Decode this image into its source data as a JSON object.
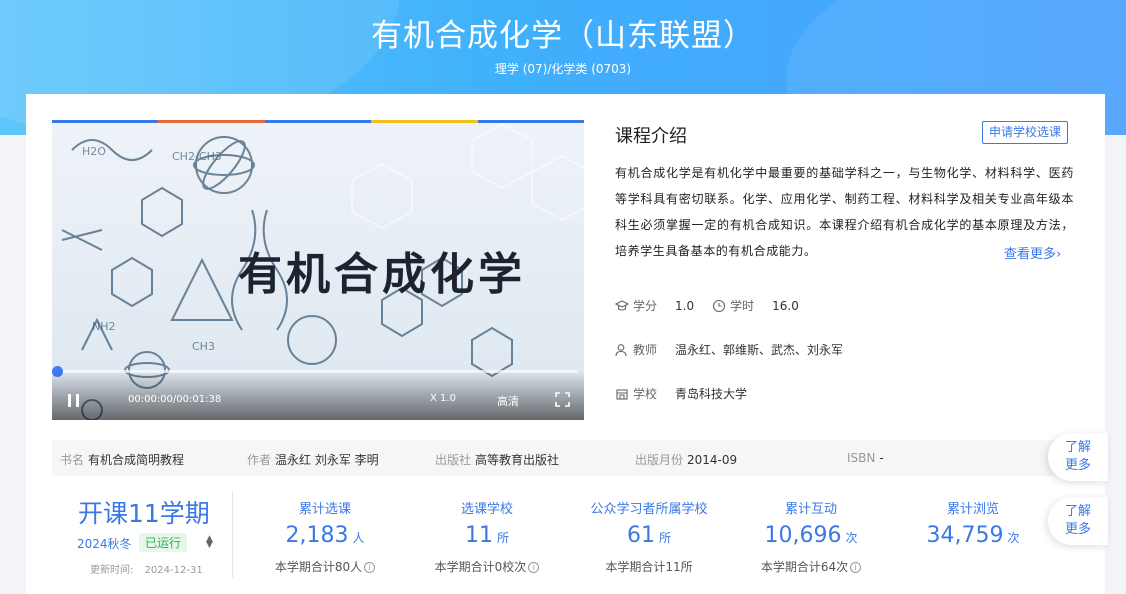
{
  "header": {
    "title": "有机合成化学（山东联盟）",
    "category": "理学 (07)/化学类 (0703)"
  },
  "video": {
    "caption": "有机合成化学",
    "time": "00:00:00/00:01:38",
    "speed": "X 1.0",
    "quality": "高清",
    "progress": 0.0
  },
  "intro": {
    "title": "课程介绍",
    "apply_label": "申请学校选课",
    "text": "有机合成化学是有机化学中最重要的基础学科之一，与生物化学、材料科学、医药等学科具有密切联系。化学、应用化学、制药工程、材料科学及相关专业高年级本科生必须掌握一定的有机合成知识。本课程介绍有机合成化学的基本原理及方法，培养学生具备基本的有机合成能力。",
    "see_more": "查看更多"
  },
  "meta": {
    "credit_label": "学分",
    "credit_value": "1.0",
    "hours_label": "学时",
    "hours_value": "16.0",
    "teacher_label": "教师",
    "teacher_value": "温永红、郭维斯、武杰、刘永军",
    "school_label": "学校",
    "school_value": "青岛科技大学"
  },
  "book": {
    "name_label": "书名",
    "name_value": "有机合成简明教程",
    "author_label": "作者",
    "author_value": "温永红 刘永军 李明",
    "publisher_label": "出版社",
    "publisher_value": "高等教育出版社",
    "month_label": "出版月份",
    "month_value": "2014-09",
    "isbn_label": "ISBN",
    "isbn_value": "-"
  },
  "side": {
    "btn1": [
      "了解",
      "更多"
    ],
    "btn2": [
      "了解",
      "更多"
    ]
  },
  "semester": {
    "title": "开课11学期",
    "term": "2024秋冬",
    "status": "已运行",
    "update_label": "更新时间:",
    "update_value": "2024-12-31"
  },
  "stats": [
    {
      "label": "累计选课",
      "value": "2,183",
      "unit": "人",
      "foot": "本学期合计80人",
      "info": true
    },
    {
      "label": "选课学校",
      "value": "11",
      "unit": "所",
      "foot": "本学期合计0校次",
      "info": true
    },
    {
      "label": "公众学习者所属学校",
      "value": "61",
      "unit": "所",
      "foot": "本学期合计11所",
      "info": false
    },
    {
      "label": "累计互动",
      "value": "10,696",
      "unit": "次",
      "foot": "本学期合计64次",
      "info": true
    },
    {
      "label": "累计浏览",
      "value": "34,759",
      "unit": "次",
      "foot": "",
      "info": false
    }
  ],
  "colors": {
    "accent": "#3b78e7",
    "status_green": "#2eb356",
    "banner": "#3fb0fb"
  }
}
